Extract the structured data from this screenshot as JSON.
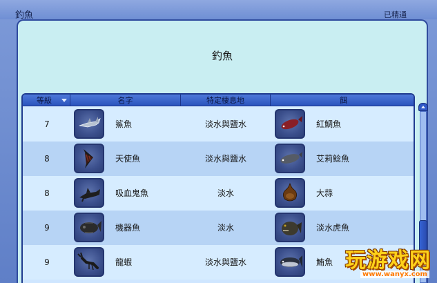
{
  "window": {
    "title": "釣魚",
    "status": "已精通"
  },
  "panel": {
    "title": "釣魚"
  },
  "table": {
    "headers": {
      "level": "等級",
      "name": "名字",
      "habitat": "特定棲息地",
      "bait": "餌"
    },
    "rows": [
      {
        "level": "7",
        "name": "鯊魚",
        "habitat": "淡水與鹽水",
        "bait": "紅鯛魚",
        "fish_icon": "shark-icon",
        "bait_icon": "red-snapper-icon"
      },
      {
        "level": "8",
        "name": "天使魚",
        "habitat": "淡水與鹽水",
        "bait": "艾莉鯰魚",
        "fish_icon": "angelfish-icon",
        "bait_icon": "catfish-icon"
      },
      {
        "level": "8",
        "name": "吸血鬼魚",
        "habitat": "淡水",
        "bait": "大蒜",
        "fish_icon": "vampire-fish-icon",
        "bait_icon": "garlic-icon"
      },
      {
        "level": "9",
        "name": "機器魚",
        "habitat": "淡水",
        "bait": "淡水虎魚",
        "fish_icon": "robot-fish-icon",
        "bait_icon": "piranha-icon"
      },
      {
        "level": "9",
        "name": "龍蝦",
        "habitat": "淡水與鹽水",
        "bait": "鮪魚",
        "fish_icon": "lobster-icon",
        "bait_icon": "tuna-icon"
      }
    ]
  },
  "watermark": {
    "text": "玩游戏网",
    "url": "www.wanyx.com"
  }
}
